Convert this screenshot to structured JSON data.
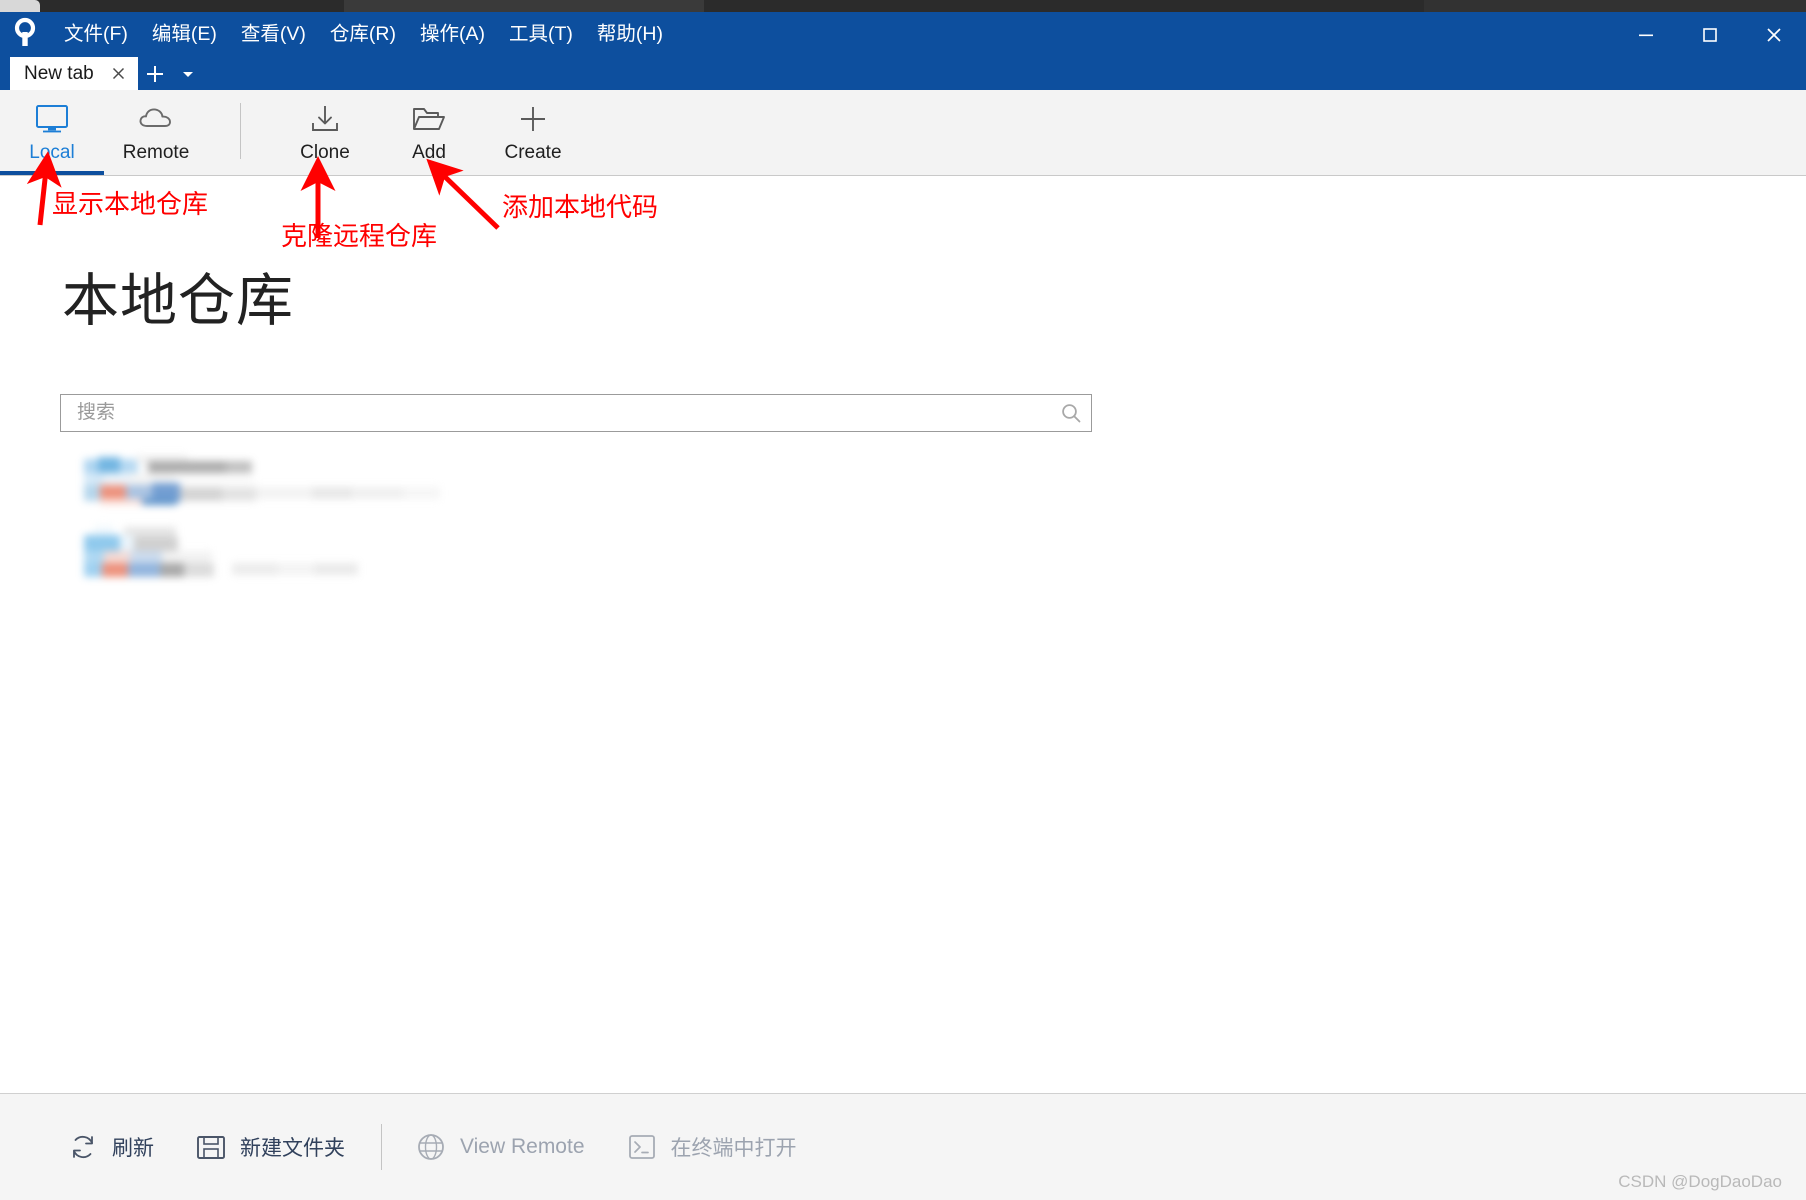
{
  "window": {
    "app_logo_icon": "fork-git-client-logo",
    "controls": {
      "minimize_label": "─",
      "maximize_label": "☐",
      "close_label": "✕"
    }
  },
  "menu": {
    "items": [
      {
        "label": "文件(F)",
        "name": "menu-file"
      },
      {
        "label": "编辑(E)",
        "name": "menu-edit"
      },
      {
        "label": "查看(V)",
        "name": "menu-view"
      },
      {
        "label": "仓库(R)",
        "name": "menu-repository"
      },
      {
        "label": "操作(A)",
        "name": "menu-actions"
      },
      {
        "label": "工具(T)",
        "name": "menu-tools"
      },
      {
        "label": "帮助(H)",
        "name": "menu-help"
      }
    ]
  },
  "tabs": {
    "active": {
      "label": "New tab",
      "close_icon": "close-icon"
    },
    "new_tab_icon": "plus-icon",
    "tab_list_icon": "chevron-down-icon"
  },
  "toolbar": {
    "buttons": [
      {
        "label": "Local",
        "icon": "monitor-icon",
        "active": true
      },
      {
        "label": "Remote",
        "icon": "cloud-icon",
        "active": false
      },
      {
        "label": "Clone",
        "icon": "download-icon",
        "active": false
      },
      {
        "label": "Add",
        "icon": "folder-open-icon",
        "active": false
      },
      {
        "label": "Create",
        "icon": "plus-icon",
        "active": false
      }
    ]
  },
  "main": {
    "page_title": "本地仓库",
    "search": {
      "placeholder": "搜索",
      "value": "",
      "icon": "search-icon"
    },
    "repositories": [
      {
        "name": "redacted-repository-1",
        "redacted": true
      },
      {
        "name": "redacted-repository-2",
        "redacted": true
      }
    ]
  },
  "annotations": {
    "accent_color": "#ff0000",
    "items": [
      {
        "text": "显示本地仓库",
        "target": "Local",
        "name": "annotation-show-local-repos"
      },
      {
        "text": "克隆远程仓库",
        "target": "Clone",
        "name": "annotation-clone-remote-repo"
      },
      {
        "text": "添加本地代码",
        "target": "Add",
        "name": "annotation-add-local-code"
      }
    ]
  },
  "bottom_bar": {
    "buttons": [
      {
        "label": "刷新",
        "icon": "refresh-icon",
        "disabled": false
      },
      {
        "label": "新建文件夹",
        "icon": "new-folder-icon",
        "disabled": false
      },
      {
        "label": "View Remote",
        "icon": "globe-icon",
        "disabled": true
      },
      {
        "label": "在终端中打开",
        "icon": "terminal-icon",
        "disabled": true
      }
    ]
  },
  "watermark": {
    "text": "CSDN @DogDaoDao"
  }
}
